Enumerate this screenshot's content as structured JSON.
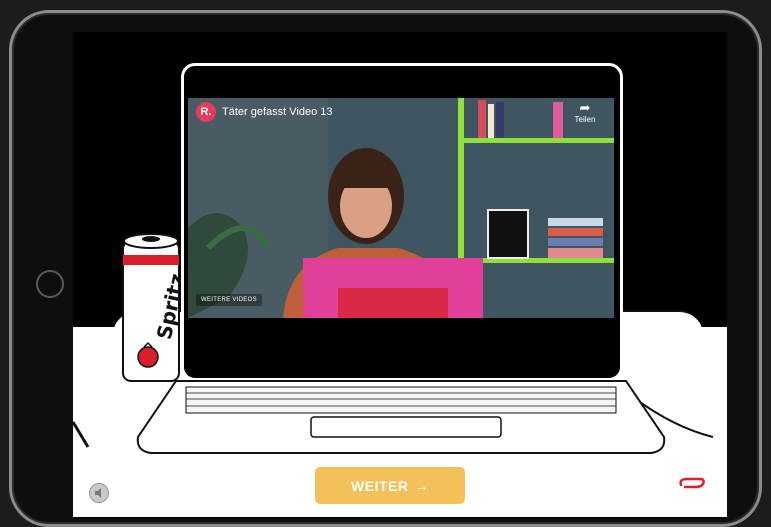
{
  "video": {
    "channel_initial": "R.",
    "title": "Täter gefasst Video 13",
    "share_label": "Teilen",
    "more_videos_label": "WEITERE VIDEOS"
  },
  "can": {
    "brand": "Spritz"
  },
  "footer": {
    "next_label": "WEITER",
    "next_arrow": "→"
  },
  "colors": {
    "accent_button": "#f4c05a",
    "avatar": "#e83a5b",
    "clip": "#e0202a"
  },
  "icons": [
    "share-arrow-icon",
    "sound-icon",
    "paperclip-icon",
    "arrow-right-icon"
  ]
}
